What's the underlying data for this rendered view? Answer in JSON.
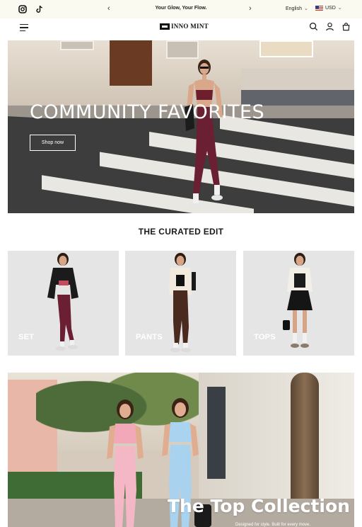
{
  "announcement": {
    "message": "Your Glow, Your Flow.",
    "prev_arrow": "‹",
    "next_arrow": "›",
    "language": "English",
    "currency": "USD",
    "social_icons": [
      "instagram-icon",
      "tiktok-icon"
    ]
  },
  "header": {
    "brand": "INNO MINT",
    "icons": [
      "menu-icon",
      "search-icon",
      "account-icon",
      "cart-icon"
    ]
  },
  "hero": {
    "headline": "COMMUNITY FAVORITES",
    "cta_label": "Shop now"
  },
  "curated": {
    "title": "THE CURATED EDIT",
    "cards": [
      {
        "label": "SET"
      },
      {
        "label": "PANTS"
      },
      {
        "label": "TOPS"
      }
    ]
  },
  "banner": {
    "headline": "The Top Collection",
    "subtext": "Designed for style. Built for every move."
  },
  "colors": {
    "announcement_bg": "#fbfaf1",
    "card_bg": "#e5e5e5",
    "text_dark": "#1a1a1a"
  }
}
